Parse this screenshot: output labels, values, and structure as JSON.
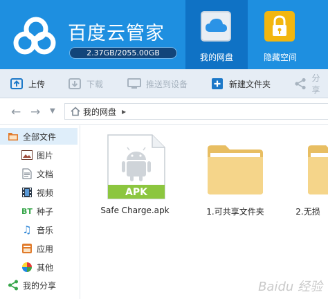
{
  "app": {
    "title": "百度云管家",
    "quota": "2.37GB/2055.00GB"
  },
  "nav_tabs": [
    {
      "label": "我的网盘",
      "icon": "cloud-icon",
      "active": true
    },
    {
      "label": "隐藏空间",
      "icon": "lock-icon",
      "active": false
    }
  ],
  "toolbar": {
    "upload": "上传",
    "download": "下载",
    "push_to_device": "推送到设备",
    "new_folder": "新建文件夹",
    "share": "分享"
  },
  "addressbar": {
    "breadcrumb": "我的网盘"
  },
  "sidebar": {
    "all_files": "全部文件",
    "items": [
      "图片",
      "文档",
      "视频",
      "种子",
      "音乐",
      "应用",
      "其他"
    ],
    "my_share": "我的分享"
  },
  "files": [
    {
      "name": "Safe Charge.apk",
      "type": "apk",
      "badge": "APK"
    },
    {
      "name": "1.可共享文件夹",
      "type": "folder"
    },
    {
      "name": "2.无损",
      "type": "folder"
    }
  ],
  "watermark": "Baidu 经验",
  "colors": {
    "header": "#1e8fe0",
    "active_tab": "#0f72c5",
    "toolbar": "#e6edf5",
    "apk_badge": "#8cc63f",
    "folder": "#f5d58a"
  }
}
